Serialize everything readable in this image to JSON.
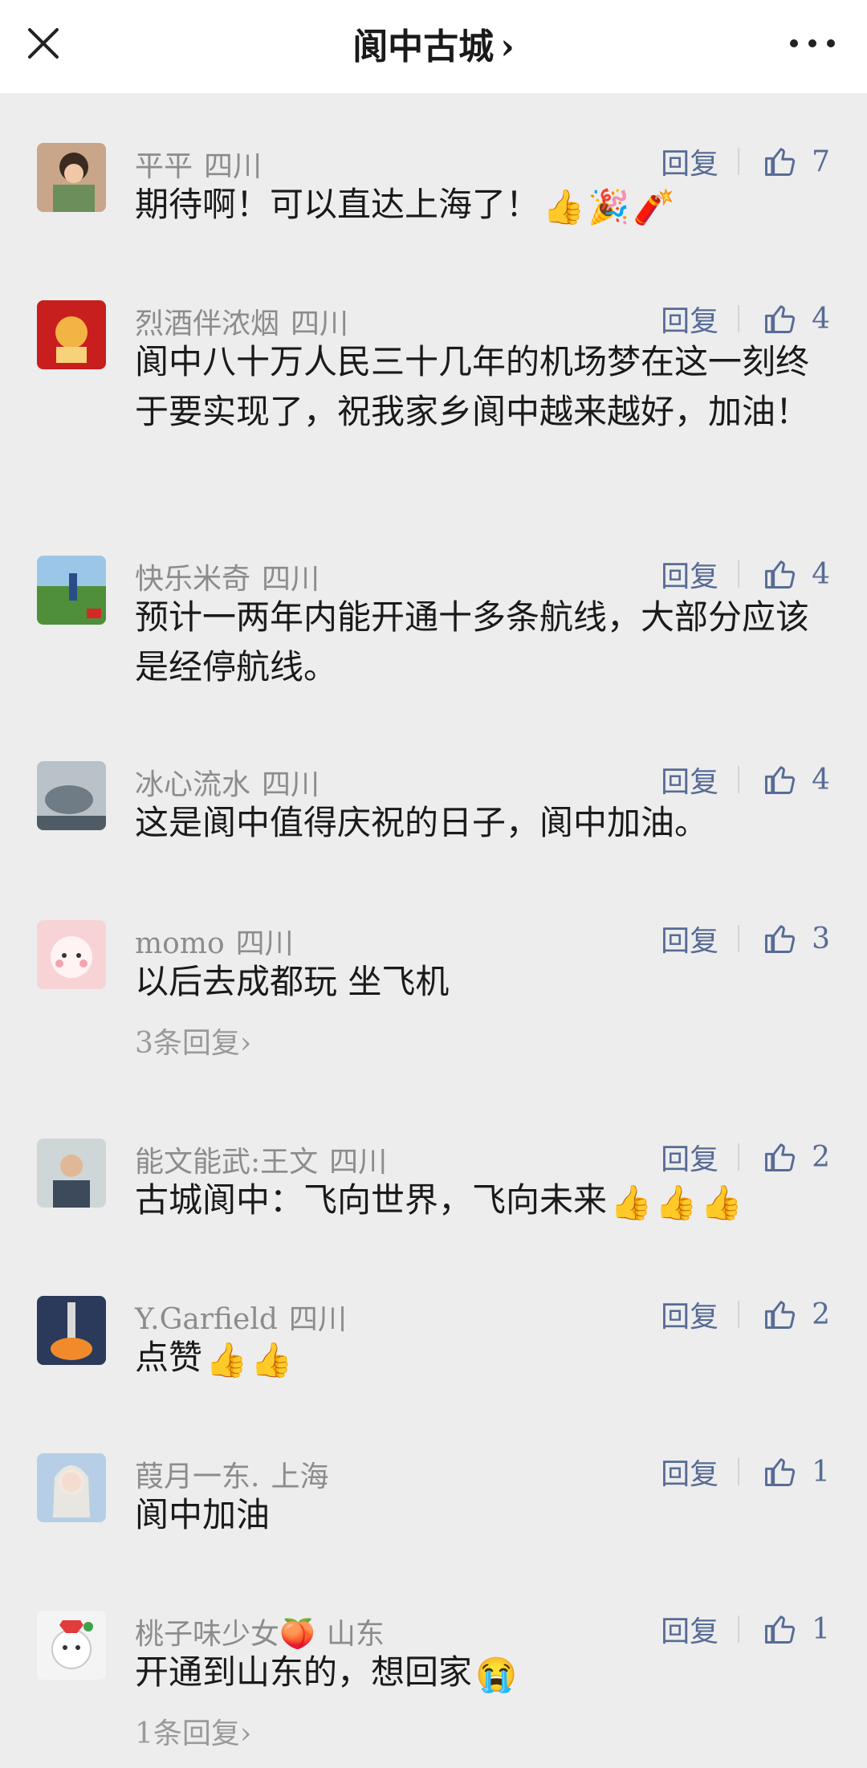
{
  "header": {
    "title": "阆中古城",
    "chevron": "›"
  },
  "comments": [
    {
      "user": "平平",
      "location": "四川",
      "reply_label": "回复",
      "likes": "7",
      "text": "期待啊！可以直达上海了！",
      "emojis": [
        "👍",
        "🎉",
        "🧨"
      ]
    },
    {
      "user": "烈酒伴浓烟",
      "location": "四川",
      "reply_label": "回复",
      "likes": "4",
      "text": "阆中八十万人民三十几年的机场梦在这一刻终于要实现了，祝我家乡阆中越来越好，加油！"
    },
    {
      "user": "快乐米奇",
      "location": "四川",
      "reply_label": "回复",
      "likes": "4",
      "text": "预计一两年内能开通十多条航线，大部分应该是经停航线。"
    },
    {
      "user": "冰心流水",
      "location": "四川",
      "reply_label": "回复",
      "likes": "4",
      "text": "这是阆中值得庆祝的日子，阆中加油。"
    },
    {
      "user": "momo",
      "location": "四川",
      "reply_label": "回复",
      "likes": "3",
      "text": "以后去成都玩 坐飞机",
      "more_replies": "3条回复›"
    },
    {
      "user": "能文能武:王文",
      "location": "四川",
      "reply_label": "回复",
      "likes": "2",
      "text": "古城阆中：飞向世界，飞向未来",
      "emojis": [
        "👍",
        "👍",
        "👍"
      ]
    },
    {
      "user": "Y.Garfield",
      "location": "四川",
      "reply_label": "回复",
      "likes": "2",
      "text": "点赞",
      "emojis": [
        "👍",
        "👍"
      ]
    },
    {
      "user": "葭月一东.",
      "location": "上海",
      "reply_label": "回复",
      "likes": "1",
      "text": "阆中加油"
    },
    {
      "user": "桃子味少女🍑",
      "location": "山东",
      "reply_label": "回复",
      "likes": "1",
      "text": "开通到山东的，想回家",
      "emojis": [
        "😭"
      ],
      "more_replies": "1条回复›"
    }
  ]
}
